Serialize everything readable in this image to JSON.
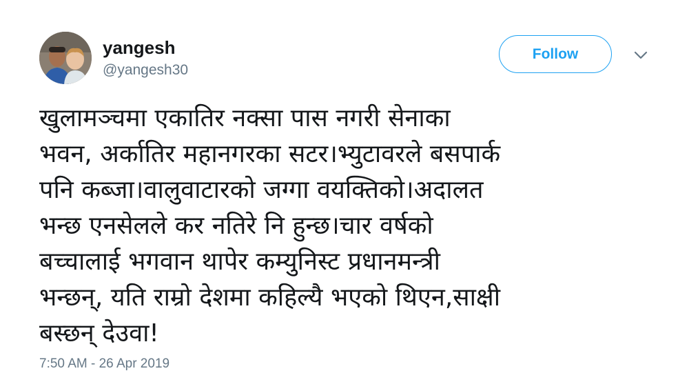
{
  "user": {
    "display_name": "yangesh",
    "handle": "@yangesh30"
  },
  "follow_button": {
    "label": "Follow"
  },
  "menu": {
    "icon": "chevron-down-icon"
  },
  "tweet": {
    "lines": [
      "खुलामञ्चमा एकातिर नक्सा पास नगरी सेनाका",
      "भवन, अर्कातिर महानगरका सटर।भ्युटावरले बसपार्क",
      "पनि कब्जा।वालुवाटारको जग्गा वयक्तिको।अदालत",
      "भन्छ एनसेलले कर नतिरे नि हुन्छ।चार वर्षको",
      "बच्चालाई भगवान थापेर कम्युनिस्ट प्रधानमन्त्री",
      "भन्छन्, यति राम्रो देशमा कहिल्यै भएको थिएन,साक्षी",
      "बस्छन् देउवा!"
    ]
  },
  "timestamp": "7:50 AM - 26 Apr 2019",
  "colors": {
    "accent": "#1da1f2",
    "secondary_text": "#657786",
    "primary_text": "#14171a"
  }
}
